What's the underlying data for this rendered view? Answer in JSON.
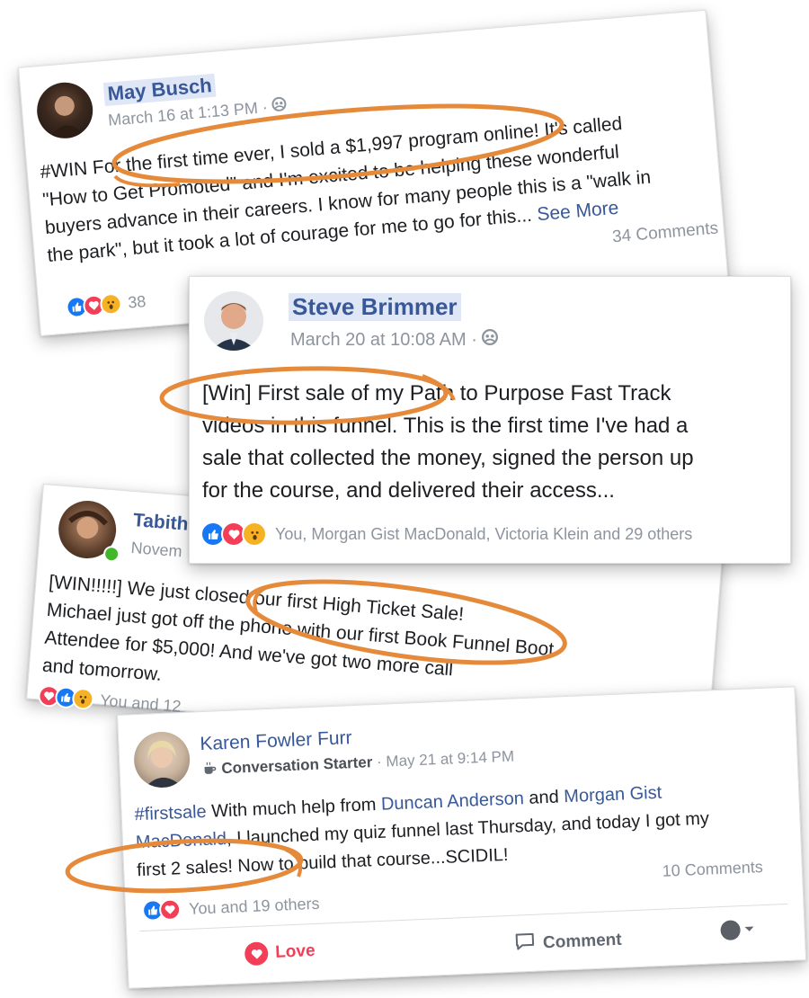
{
  "colors": {
    "facebook_blue": "#385898",
    "annotation_orange": "#e58a3a",
    "meta_gray": "#8d949e"
  },
  "posts": [
    {
      "author": "May Busch",
      "timestamp": "March 16 at 1:13 PM",
      "privacy_icon": "group-icon",
      "body_lines": [
        "#WIN For the first time ever, I sold a $1,997 program online! It's called",
        "\"How to Get Promoted\" and I'm excited to be helping these wonderful",
        "buyers advance in their careers. I know for many people this is a \"walk in",
        "the park\", but it took a lot of courage for me to go for this..."
      ],
      "see_more": "See More",
      "comments": "34 Comments",
      "reaction_icons": [
        "like-icon",
        "love-icon",
        "wow-icon"
      ],
      "reaction_count": "38"
    },
    {
      "author": "Steve Brimmer",
      "timestamp": "March 20 at 10:08 AM",
      "privacy_icon": "group-icon",
      "body_lines": [
        "[Win] First sale of my Path to Purpose Fast Track",
        "videos in this funnel. This is the first time I've had a",
        "sale that collected the money, signed the person up",
        "for the course, and delivered their access..."
      ],
      "reaction_icons": [
        "like-icon",
        "love-icon",
        "wow-icon"
      ],
      "reaction_text": "You, Morgan Gist MacDonald, Victoria Klein and 29 others"
    },
    {
      "author": "Tabith",
      "timestamp": "Novem",
      "body_lines": [
        "[WIN!!!!!] We just closed our first High Ticket Sale!",
        "Michael just got off the phone with our first Book Funnel Boot",
        "Attendee for $5,000! And we've got two more call",
        "and tomorrow."
      ],
      "reaction_icons": [
        "love-icon",
        "like-icon",
        "wow-icon"
      ],
      "reaction_text": "You and 12"
    },
    {
      "author": "Karen Fowler Furr",
      "badge": "Conversation Starter",
      "timestamp": "May 21 at 9:14 PM",
      "body": {
        "hashtag": "#firstsale",
        "t1": " With much help from ",
        "mention1": "Duncan Anderson",
        "t2": " and ",
        "mention2_a": "Morgan Gist",
        "mention2_b": "MacDonald",
        "t3": ", I launched my quiz funnel last Thursday, and today I got my",
        "line3": "first 2 sales! Now to build that course...SCIDIL!"
      },
      "comments": "10 Comments",
      "reaction_icons": [
        "like-icon",
        "love-icon"
      ],
      "reaction_text": "You and 19 others",
      "actions": {
        "love": "Love",
        "comment": "Comment"
      }
    }
  ]
}
